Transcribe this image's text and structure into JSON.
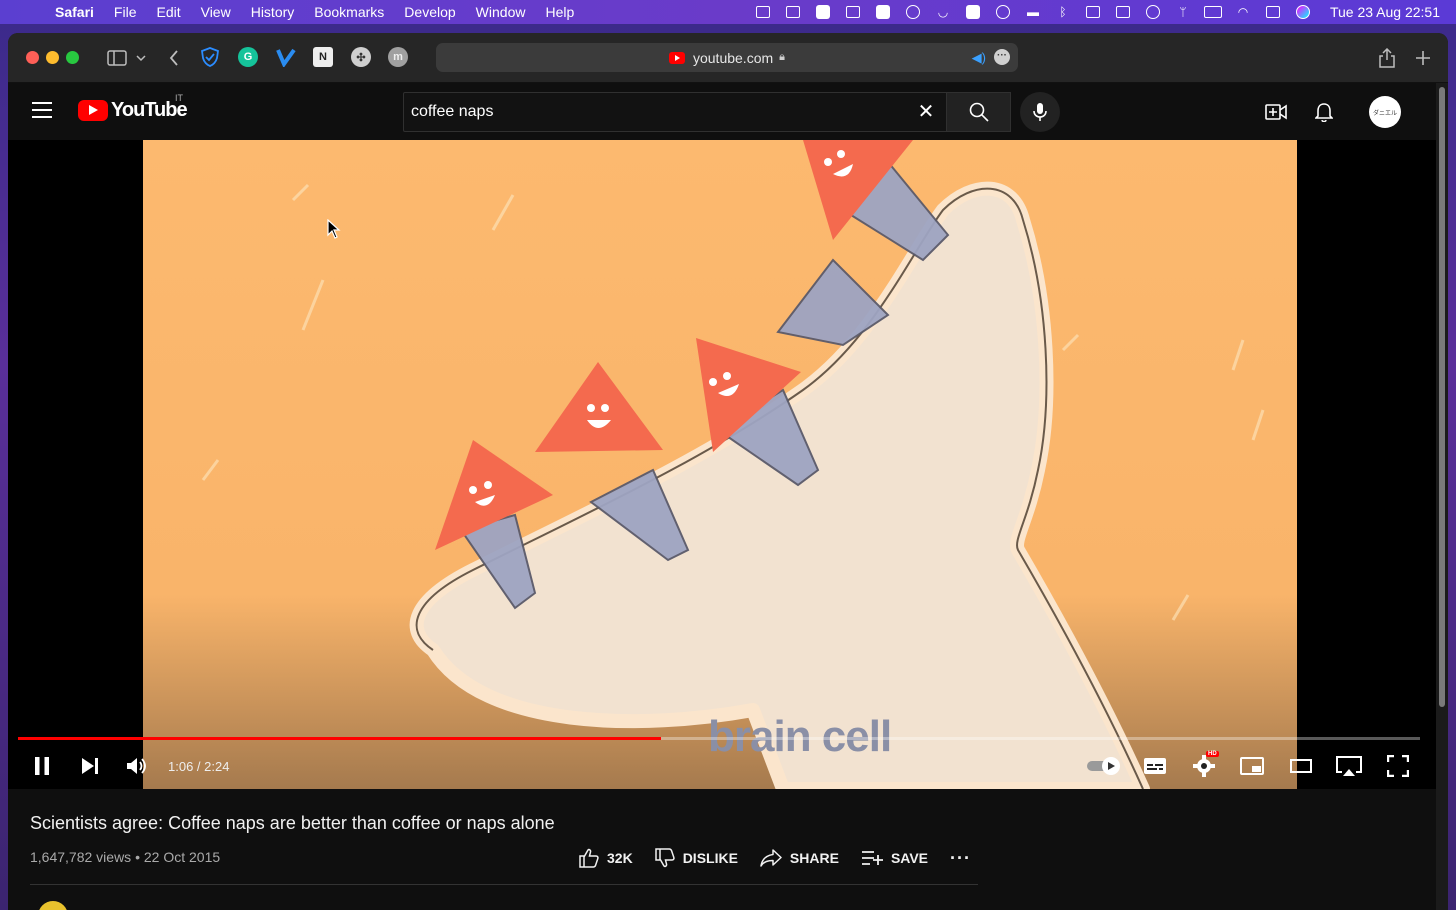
{
  "menubar": {
    "app": "Safari",
    "items": [
      "File",
      "Edit",
      "View",
      "History",
      "Bookmarks",
      "Develop",
      "Window",
      "Help"
    ],
    "clock": "Tue 23 Aug  22:51"
  },
  "browser": {
    "url": "youtube.com"
  },
  "youtube": {
    "logo_text": "YouTube",
    "country_code": "IT",
    "search_value": "coffee naps",
    "avatar_text": "ダニエル"
  },
  "player": {
    "time_current": "1:06",
    "time_total": "2:24",
    "time_display": "1:06 / 2:24",
    "progress": 0.4583,
    "overlay_text": "brain cell",
    "hd_label": "HD"
  },
  "video": {
    "title": "Scientists agree: Coffee naps are better than coffee or naps alone",
    "meta": "1,647,782 views • 22 Oct 2015",
    "likes": "32K",
    "dislike_label": "DISLIKE",
    "share_label": "SHARE",
    "save_label": "SAVE"
  },
  "colors": {
    "accent": "#ff0000",
    "video_bg": "#fbb66c",
    "brain_fill": "#f3e2cf"
  }
}
